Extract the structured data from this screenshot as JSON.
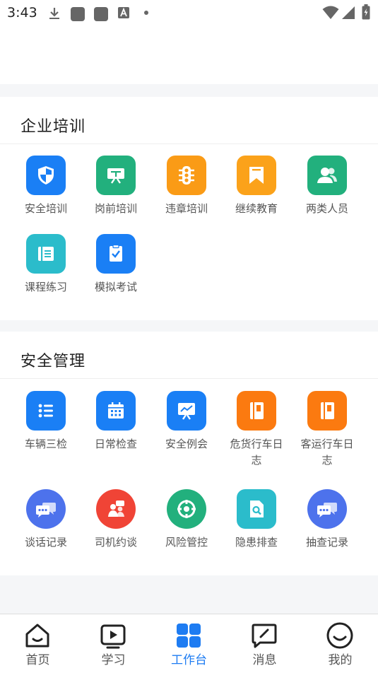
{
  "status_bar": {
    "time": "3:43"
  },
  "sections": [
    {
      "title": "企业培训",
      "items": [
        {
          "label": "安全培训",
          "icon": "shield-icon",
          "color": "#1a7ff5"
        },
        {
          "label": "岗前培训",
          "icon": "presentation-icon",
          "color": "#22b07d"
        },
        {
          "label": "违章培训",
          "icon": "traffic-light-icon",
          "color": "#fa9b16"
        },
        {
          "label": "继续教育",
          "icon": "bookmark-icon",
          "color": "#fba21a"
        },
        {
          "label": "两类人员",
          "icon": "people-icon",
          "color": "#22b07d"
        },
        {
          "label": "课程练习",
          "icon": "notebook-icon",
          "color": "#2bbccb"
        },
        {
          "label": "模拟考试",
          "icon": "exam-icon",
          "color": "#1a7ff5"
        }
      ]
    },
    {
      "title": "安全管理",
      "items": [
        {
          "label": "车辆三检",
          "icon": "list-icon",
          "color": "#1a7ff5"
        },
        {
          "label": "日常检查",
          "icon": "calendar-icon",
          "color": "#1a7ff5"
        },
        {
          "label": "安全例会",
          "icon": "meeting-board-icon",
          "color": "#1a7ff5"
        },
        {
          "label": "危货行车日志",
          "icon": "logbook-icon",
          "color": "#fb7a10"
        },
        {
          "label": "客运行车日志",
          "icon": "logbook-icon",
          "color": "#fb7a10"
        },
        {
          "label": "谈话记录",
          "icon": "chat-icon",
          "color": "#4d72ec"
        },
        {
          "label": "司机约谈",
          "icon": "interview-icon",
          "color": "#f04436"
        },
        {
          "label": "风险管控",
          "icon": "target-icon",
          "color": "#22b07d"
        },
        {
          "label": "隐患排查",
          "icon": "search-doc-icon",
          "color": "#2bbccb"
        },
        {
          "label": "抽查记录",
          "icon": "chat-icon",
          "color": "#4d72ec"
        }
      ]
    }
  ],
  "bottom_nav": [
    {
      "label": "首页",
      "icon": "home-icon"
    },
    {
      "label": "学习",
      "icon": "play-icon"
    },
    {
      "label": "工作台",
      "icon": "workbench-icon",
      "active": true
    },
    {
      "label": "消息",
      "icon": "message-icon"
    },
    {
      "label": "我的",
      "icon": "smile-icon"
    }
  ],
  "colors": {
    "accent": "#1e7cf2",
    "background": "#f5f6f8"
  }
}
